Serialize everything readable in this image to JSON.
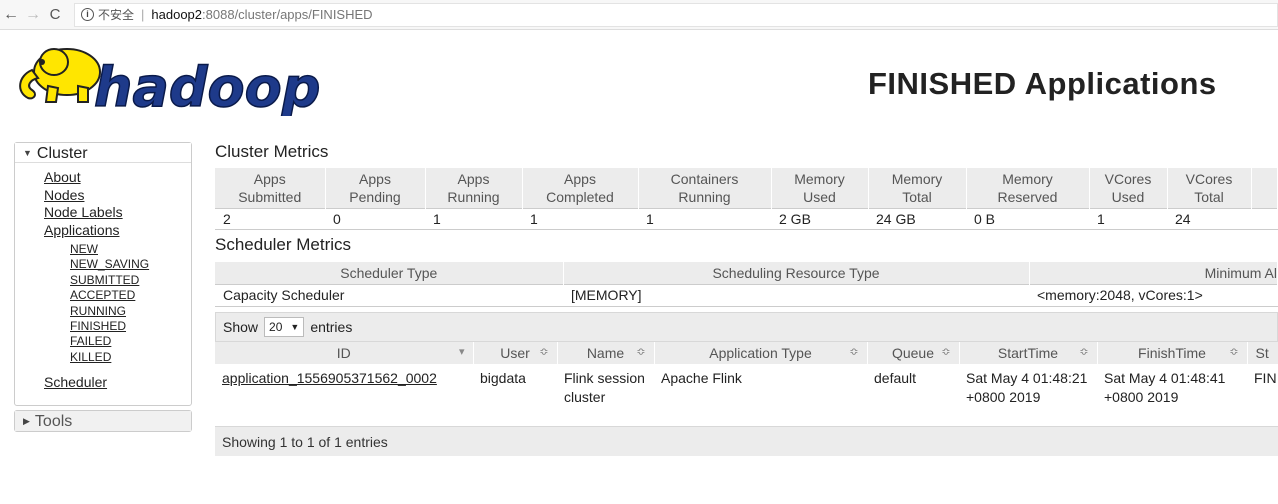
{
  "browser": {
    "back": "←",
    "forward": "→",
    "reload": "C",
    "info": "i",
    "insecure": "不安全",
    "separator": "|",
    "host": "hadoop2",
    "path": ":8088/cluster/apps/FINISHED"
  },
  "header": {
    "logo_text": "hadoop",
    "title": "FINISHED Applications"
  },
  "sidebar": {
    "cluster_label": "Cluster",
    "links": [
      "About",
      "Nodes",
      "Node Labels",
      "Applications"
    ],
    "app_states": [
      "NEW",
      "NEW_SAVING",
      "SUBMITTED",
      "ACCEPTED",
      "RUNNING",
      "FINISHED",
      "FAILED",
      "KILLED"
    ],
    "scheduler": "Scheduler",
    "tools_label": "Tools"
  },
  "cluster_metrics": {
    "title": "Cluster Metrics",
    "headers": [
      [
        "Apps",
        "Submitted"
      ],
      [
        "Apps",
        "Pending"
      ],
      [
        "Apps",
        "Running"
      ],
      [
        "Apps",
        "Completed"
      ],
      [
        "Containers",
        "Running"
      ],
      [
        "Memory",
        "Used"
      ],
      [
        "Memory",
        "Total"
      ],
      [
        "Memory",
        "Reserved"
      ],
      [
        "VCores",
        "Used"
      ],
      [
        "VCores",
        "Total"
      ]
    ],
    "values": [
      "2",
      "0",
      "1",
      "1",
      "1",
      "2 GB",
      "24 GB",
      "0 B",
      "1",
      "24"
    ]
  },
  "scheduler_metrics": {
    "title": "Scheduler Metrics",
    "headers": [
      "Scheduler Type",
      "Scheduling Resource Type",
      "Minimum Al"
    ],
    "values": [
      "Capacity Scheduler",
      "[MEMORY]",
      "<memory:2048, vCores:1>"
    ]
  },
  "apps": {
    "show_label": "Show",
    "entries_count": "20",
    "entries_label": "entries",
    "headers": [
      "ID",
      "User",
      "Name",
      "Application Type",
      "Queue",
      "StartTime",
      "FinishTime",
      "St"
    ],
    "sort_icons": [
      "▾",
      "≎",
      "≎",
      "≎",
      "≎",
      "≎",
      "≎",
      ""
    ],
    "rows": [
      {
        "id": "application_1556905371562_0002",
        "user": "bigdata",
        "name": "Flink session cluster",
        "type": "Apache Flink",
        "queue": "default",
        "start": "Sat May 4 01:48:21 +0800 2019",
        "finish": "Sat May 4 01:48:41 +0800 2019",
        "state": "FIN"
      }
    ],
    "footer": "Showing 1 to 1 of 1 entries"
  },
  "colors": {
    "header_bg": "#ececec",
    "logo_yellow": "#ffe600",
    "logo_blue": "#1e3a8a"
  }
}
